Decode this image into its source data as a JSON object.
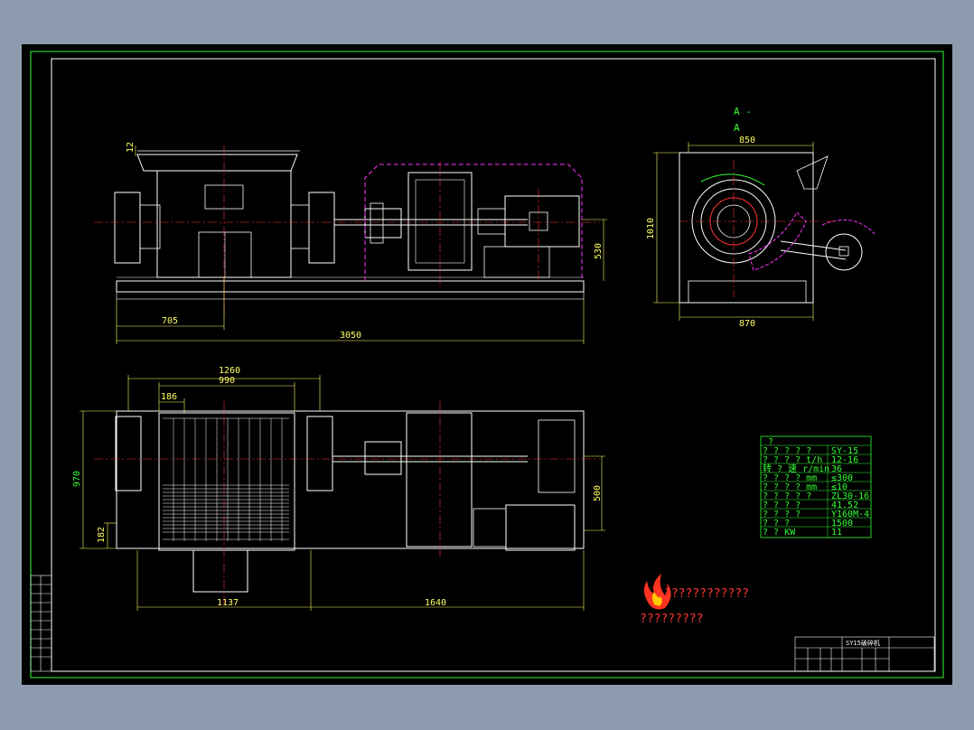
{
  "colors": {
    "background": "#8e9bae",
    "sheet": "#000000",
    "frame": "#33ff33",
    "geometry": "#ffffff",
    "centerline": "#ff3333",
    "dimension": "#ffff66",
    "hidden": "#ff33ff"
  },
  "section_label": {
    "line1": "A -",
    "line2": "A"
  },
  "front_view": {
    "dims": {
      "d705": "705",
      "d3050": "3050",
      "d530": "530",
      "d12": "12"
    }
  },
  "section_view": {
    "dims": {
      "d850": "850",
      "d1010": "1010",
      "d870": "870"
    }
  },
  "top_view": {
    "dims": {
      "d1260": "1260",
      "d990": "990",
      "d186": "186",
      "d970": "970",
      "d182": "182",
      "d500": "500",
      "d1137": "1137",
      "d1640": "1640"
    }
  },
  "tech_table": {
    "rows": [
      [
        "?",
        "?",
        "?",
        "?",
        "?",
        "?",
        "?",
        "?",
        "?"
      ],
      [
        "?  ?  ?  ?  ?",
        "SY-15"
      ],
      [
        "?  ?  ?  ?  t/h",
        "12-16"
      ],
      [
        "转  ?  速  r/min",
        "36"
      ],
      [
        "?  ?  ?  ?  mm",
        "≤300"
      ],
      [
        "?  ?  ?  ?  mm",
        "≤10"
      ],
      [
        "? ? ?  ?  ?",
        "ZL30-16"
      ],
      [
        "?  ?  ?  ?",
        "41.52"
      ],
      [
        "?  ?  ?  ?",
        "Y160M-4"
      ],
      [
        "?  ?  ?",
        "1500"
      ],
      [
        "?  ?  KW",
        "11"
      ]
    ]
  },
  "logo": {
    "line1": "????????????",
    "line2": "?????????"
  },
  "title_block": {
    "drawing_no": "SY15破碎机"
  }
}
